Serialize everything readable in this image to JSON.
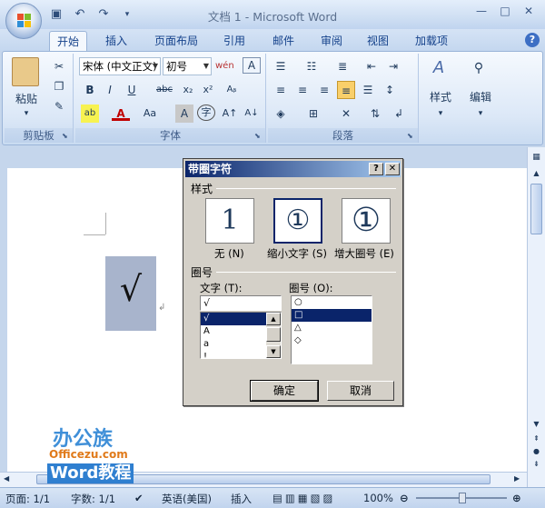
{
  "window": {
    "title": "文档 1 - Microsoft Word",
    "controls": [
      "—",
      "□",
      "✕"
    ]
  },
  "qat": {
    "icons": [
      "save-icon",
      "undo-icon",
      "redo-icon",
      "customize-icon"
    ]
  },
  "tabs": [
    {
      "label": "开始",
      "active": true
    },
    {
      "label": "插入"
    },
    {
      "label": "页面布局"
    },
    {
      "label": "引用"
    },
    {
      "label": "邮件"
    },
    {
      "label": "审阅"
    },
    {
      "label": "视图"
    },
    {
      "label": "加载项"
    }
  ],
  "ribbon": {
    "clipboard": {
      "label": "剪贴板",
      "paste": "粘贴"
    },
    "font": {
      "label": "字体",
      "font_name": "宋体 (中文正文)",
      "font_size": "初号"
    },
    "paragraph": {
      "label": "段落"
    },
    "styles": {
      "label": "样式"
    },
    "editing": {
      "label": "编辑"
    }
  },
  "document": {
    "enclosed_char": "√"
  },
  "dialog": {
    "title": "带圈字符",
    "help_btn": "?",
    "close_btn": "✕",
    "style_section": "样式",
    "styles": [
      {
        "label": "无 (N)",
        "glyph": "1"
      },
      {
        "label": "缩小文字 (S)",
        "glyph": "①",
        "selected": true
      },
      {
        "label": "增大圈号 (E)",
        "glyph": "①"
      }
    ],
    "enclosure_section": "圈号",
    "text_label": "文字 (T):",
    "text_value": "√",
    "text_list": [
      "√",
      "A",
      "a",
      "!"
    ],
    "enclose_label": "圈号 (O):",
    "enclose_list": [
      "○",
      "□",
      "△",
      "◇"
    ],
    "ok": "确定",
    "cancel": "取消"
  },
  "status": {
    "page": "页面: 1/1",
    "words": "字数: 1/1",
    "language": "英语(美国)",
    "mode": "插入",
    "zoom": "100%"
  },
  "watermark": {
    "line1": "办公族",
    "line2": "Officezu.com",
    "line3": "Word教程"
  },
  "colors": {
    "accent": "#15428b",
    "dialog_title": "#0a246a",
    "selection": "#0a246a"
  }
}
